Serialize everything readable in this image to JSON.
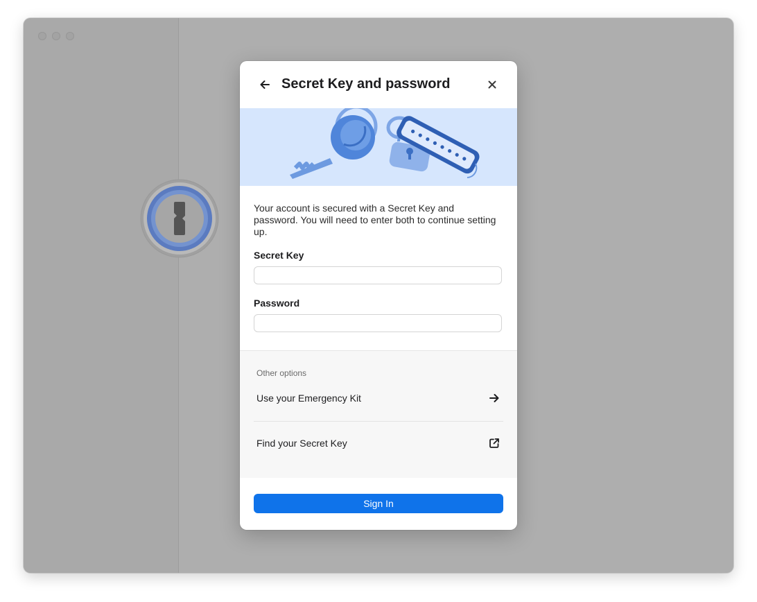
{
  "dialog": {
    "title": "Secret Key and password",
    "description": "Your account is secured with a Secret Key and password. You will need to enter both to continue setting up.",
    "secret_key_label": "Secret Key",
    "secret_key_value": "",
    "password_label": "Password",
    "password_value": "",
    "other_options_heading": "Other options",
    "options": [
      {
        "label": "Use your Emergency Kit",
        "icon": "arrow-right-icon"
      },
      {
        "label": "Find your Secret Key",
        "icon": "external-link-icon"
      }
    ],
    "sign_in_label": "Sign In"
  },
  "icons": {
    "back": "arrow-left-icon",
    "close": "close-icon",
    "logo": "1password-logo"
  },
  "colors": {
    "accent": "#0f73ea",
    "banner_bg": "#d6e6fd",
    "overlay": "#aeaeae"
  }
}
